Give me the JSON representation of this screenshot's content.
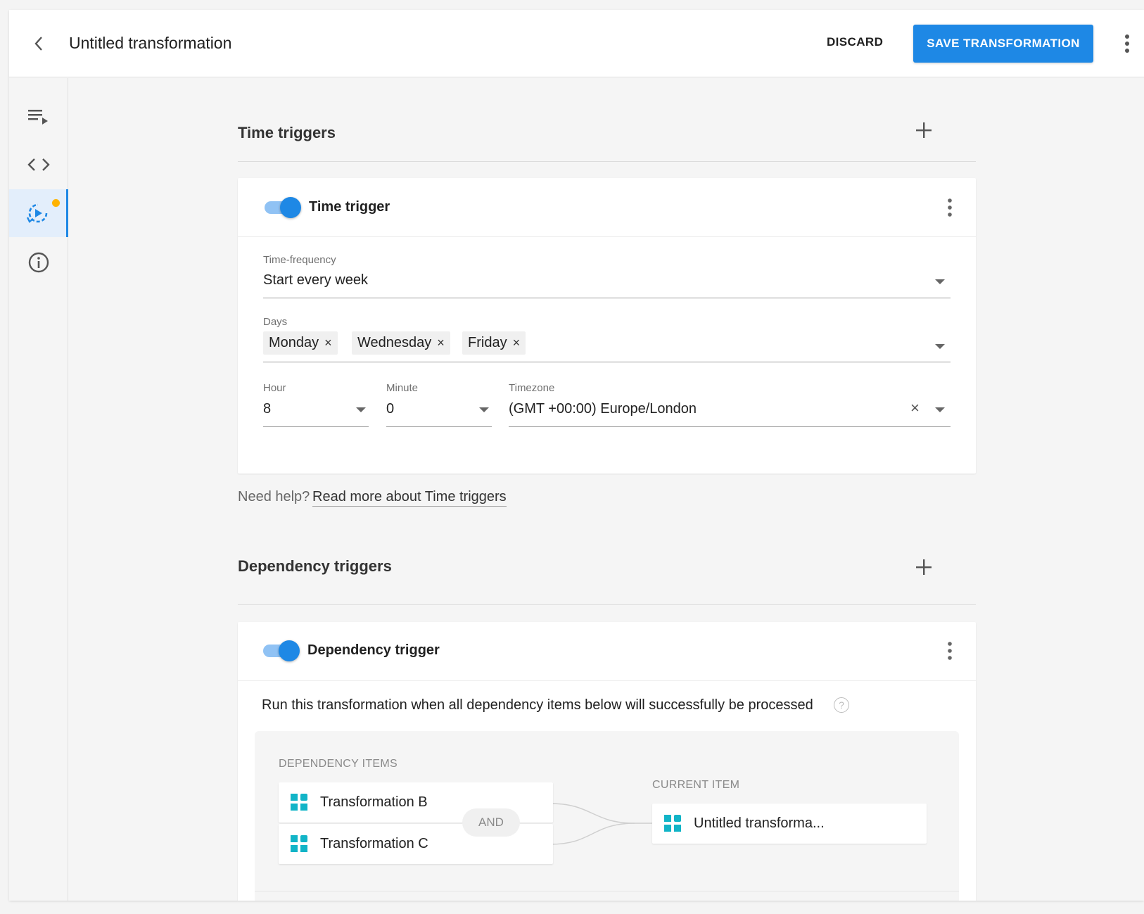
{
  "header": {
    "title": "Untitled transformation",
    "discard_label": "DISCARD",
    "save_label": "SAVE TRANSFORMATION"
  },
  "sidebar": {
    "items": [
      {
        "icon": "playlist-play-icon"
      },
      {
        "icon": "code-icon"
      },
      {
        "icon": "schedule-trigger-icon",
        "active": true,
        "badge_color": "#ffb300"
      },
      {
        "icon": "info-icon"
      }
    ]
  },
  "time_triggers": {
    "section_title": "Time triggers",
    "card": {
      "title": "Time trigger",
      "enabled": true,
      "frequency_label": "Time-frequency",
      "frequency_value": "Start every week",
      "days_label": "Days",
      "days": [
        "Monday",
        "Wednesday",
        "Friday"
      ],
      "hour_label": "Hour",
      "hour_value": "8",
      "minute_label": "Minute",
      "minute_value": "0",
      "timezone_label": "Timezone",
      "timezone_value": "(GMT +00:00) Europe/London"
    },
    "help_prefix": "Need help?",
    "help_link": "Read more about Time triggers"
  },
  "dependency_triggers": {
    "section_title": "Dependency triggers",
    "card": {
      "title": "Dependency trigger",
      "enabled": true,
      "description": "Run this transformation when all dependency items below will successfully be processed",
      "help_symbol": "?",
      "dependency_items_label": "DEPENDENCY ITEMS",
      "items": [
        "Transformation B",
        "Transformation C"
      ],
      "operator": "AND",
      "current_item_label": "CURRENT ITEM",
      "current_item": "Untitled transforma..."
    }
  },
  "colors": {
    "accent": "#1e88e5",
    "item_icon": "#11b4c7",
    "badge": "#ffb300"
  }
}
